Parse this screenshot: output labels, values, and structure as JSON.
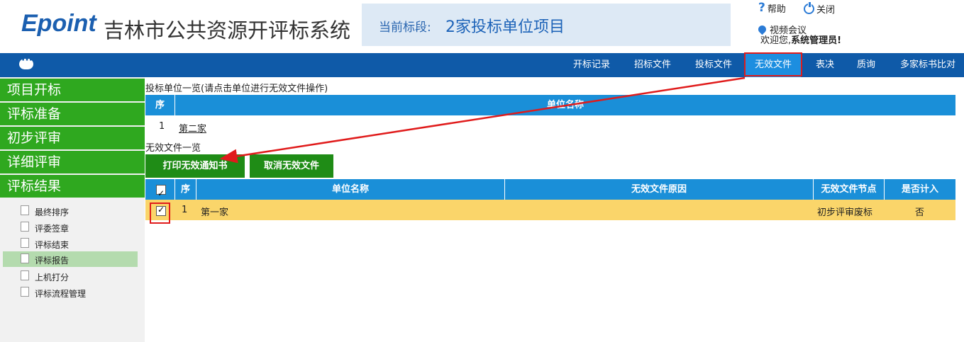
{
  "header": {
    "logo_text": "Epoint",
    "system_title": "吉林市公共资源开评标系统",
    "section_label": "当前标段:",
    "section_name": "2家投标单位项目",
    "help_label": "帮助",
    "close_label": "关闭",
    "video_label": "视频会议",
    "welcome_prefix": "欢迎您,",
    "welcome_user": "系统管理员!"
  },
  "nav": {
    "tabs": [
      {
        "label": "开标记录"
      },
      {
        "label": "招标文件"
      },
      {
        "label": "投标文件"
      },
      {
        "label": "无效文件",
        "active": true
      },
      {
        "label": "表决"
      },
      {
        "label": "质询"
      },
      {
        "label": "多家标书比对"
      }
    ]
  },
  "sidebar": {
    "stages": [
      {
        "label": "项目开标"
      },
      {
        "label": "评标准备"
      },
      {
        "label": "初步评审"
      },
      {
        "label": "详细评审"
      },
      {
        "label": "评标结果"
      }
    ],
    "items": [
      {
        "label": "最终排序"
      },
      {
        "label": "评委签章"
      },
      {
        "label": "评标结束"
      },
      {
        "label": "评标报告",
        "active": true
      },
      {
        "label": "上机打分"
      },
      {
        "label": "评标流程管理"
      }
    ]
  },
  "bidders": {
    "caption": "投标单位一览(请点击单位进行无效文件操作)",
    "col_seq": "序",
    "col_name": "单位名称",
    "rows": [
      {
        "seq": "1",
        "name": "第二家"
      }
    ]
  },
  "invalid": {
    "caption": "无效文件一览",
    "print_button": "打印无效通知书",
    "cancel_button": "取消无效文件",
    "col_seq": "序",
    "col_name": "单位名称",
    "col_reason": "无效文件原因",
    "col_node": "无效文件节点",
    "col_counted": "是否计入",
    "rows": [
      {
        "checked": true,
        "seq": "1",
        "name": "第一家",
        "reason": "",
        "node": "初步评审废标",
        "counted": "否"
      }
    ]
  },
  "colors": {
    "nav_bg": "#0f5aa8",
    "nav_active": "#1c8ee0",
    "sidebar_green": "#2fa81f",
    "table_header": "#1a8fd8",
    "button_green": "#1f8c16",
    "selected_row": "#fad56a",
    "annotation_red": "#e01b1b"
  }
}
